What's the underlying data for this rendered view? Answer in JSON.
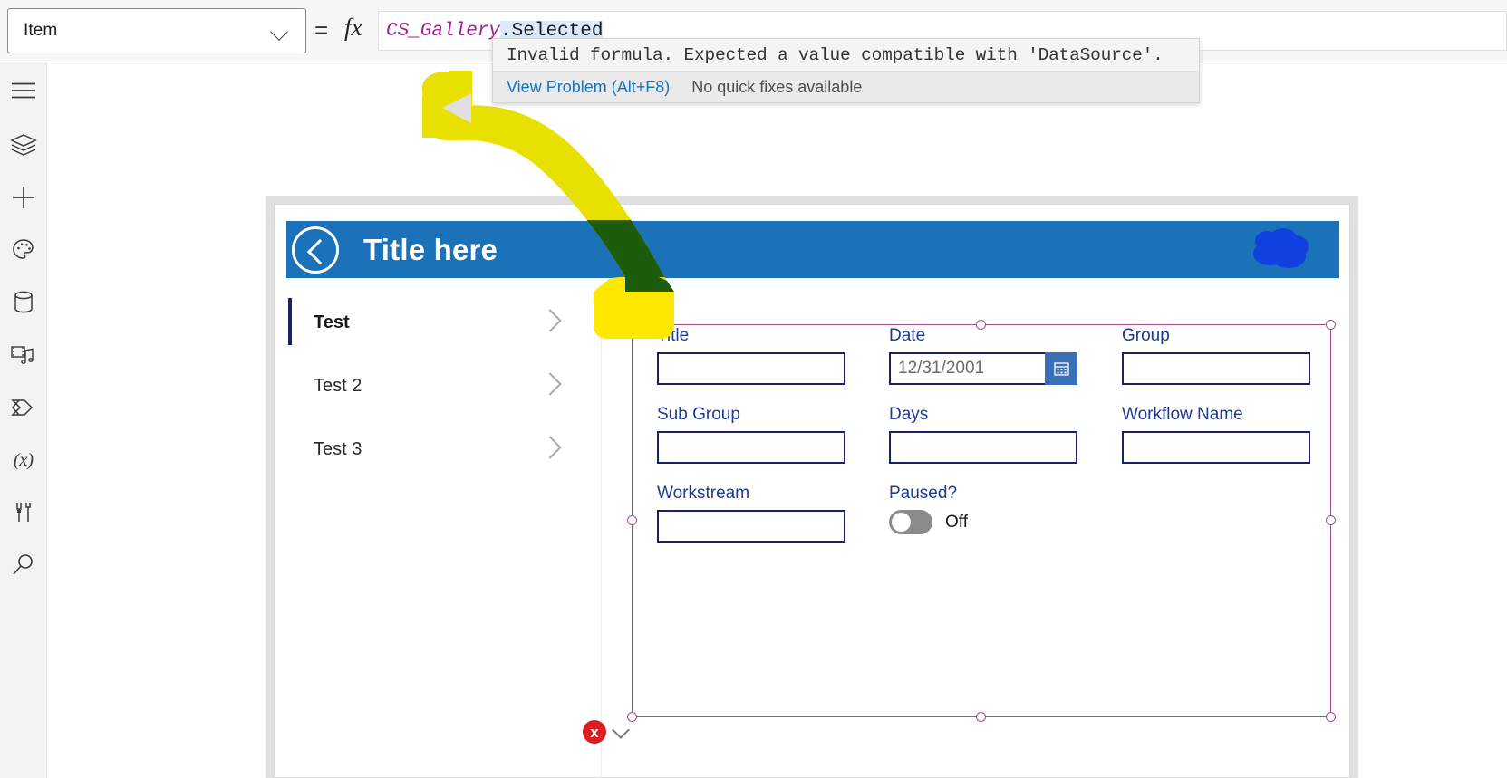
{
  "formula_bar": {
    "property_selector": {
      "value": "Item",
      "icon": "chevron-down-icon"
    },
    "equals": "=",
    "fx": "fx",
    "formula": {
      "identifier": "CS_Gallery",
      "property": ".Selected",
      "full": "CS_Gallery.Selected"
    }
  },
  "error_tooltip": {
    "message": "Invalid formula. Expected a value compatible with 'DataSource'.",
    "view_problem_link": "View Problem (Alt+F8)",
    "quick_fix_text": "No quick fixes available"
  },
  "left_rail": {
    "items": [
      {
        "name": "hamburger-menu-icon",
        "title": "Menu"
      },
      {
        "name": "tree-view-icon",
        "title": "Tree view"
      },
      {
        "name": "insert-icon",
        "title": "Insert"
      },
      {
        "name": "theme-palette-icon",
        "title": "Theme"
      },
      {
        "name": "data-sources-icon",
        "title": "Data"
      },
      {
        "name": "media-icon",
        "title": "Media"
      },
      {
        "name": "power-automate-icon",
        "title": "Power Automate"
      },
      {
        "name": "variables-icon",
        "title": "Variables"
      },
      {
        "name": "tools-icon",
        "title": "Advanced tools"
      },
      {
        "name": "search-icon",
        "title": "Search"
      }
    ]
  },
  "app": {
    "header": {
      "title": "Title here",
      "back_icon": "back-chevron-icon",
      "accent_color": "#1b72b8"
    },
    "gallery": {
      "items": [
        {
          "label": "Test",
          "selected": true
        },
        {
          "label": "Test 2",
          "selected": false
        },
        {
          "label": "Test 3",
          "selected": false
        }
      ],
      "chevron_icon": "chevron-right-icon"
    },
    "form": {
      "fields": [
        {
          "label": "Title",
          "value": "",
          "type": "text"
        },
        {
          "label": "Date",
          "value": "12/31/2001",
          "type": "date"
        },
        {
          "label": "Group",
          "value": "",
          "type": "text"
        },
        {
          "label": "Sub Group",
          "value": "",
          "type": "text"
        },
        {
          "label": "Days",
          "value": "",
          "type": "text"
        },
        {
          "label": "Workflow Name",
          "value": "",
          "type": "text"
        },
        {
          "label": "Workstream",
          "value": "",
          "type": "text"
        }
      ],
      "toggle": {
        "label": "Paused?",
        "state_label": "Off",
        "on": false
      },
      "date_picker_icon": "calendar-icon",
      "border_color": "#16216a",
      "label_color": "#1f3a93"
    }
  },
  "selection": {
    "color": "#a34f8f",
    "error_badge": {
      "symbol": "x",
      "icon": "error-x-icon",
      "chevron": "chevron-down-icon"
    }
  },
  "annotations": {
    "highlighter_color": "#e8e000",
    "blob_color": "#1040e0"
  }
}
